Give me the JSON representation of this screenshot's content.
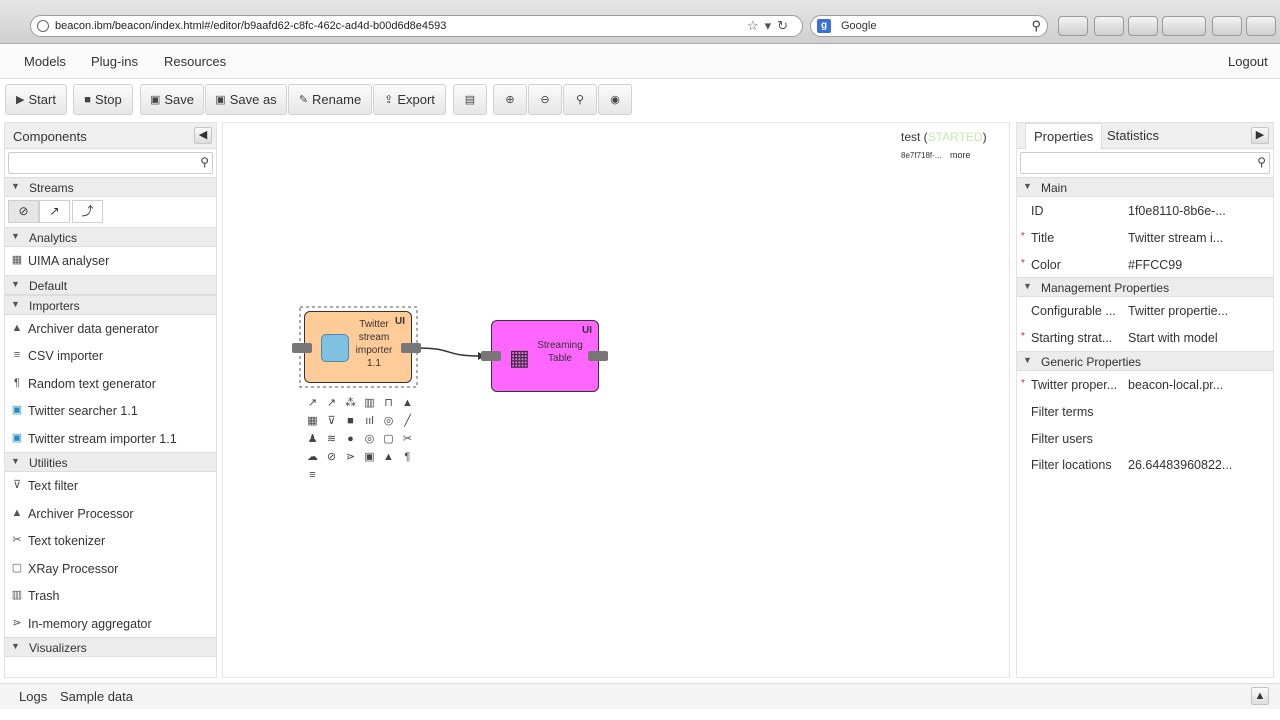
{
  "browser": {
    "url": "beacon.ibm/beacon/index.html#/editor/b9aafd62-c8fc-462c-ad4d-b00d6d8e4593",
    "search_engine": "Google"
  },
  "nav": {
    "models": "Models",
    "plugins": "Plug-ins",
    "resources": "Resources",
    "logout": "Logout"
  },
  "toolbar": {
    "start": "Start",
    "stop": "Stop",
    "save": "Save",
    "save_as": "Save as",
    "rename": "Rename",
    "export": "Export"
  },
  "components": {
    "title": "Components",
    "sections": {
      "streams": "Streams",
      "analytics": "Analytics",
      "default": "Default",
      "importers": "Importers",
      "utilities": "Utilities",
      "visualizers": "Visualizers"
    },
    "analytics": [
      "UIMA analyser"
    ],
    "importers": [
      "Archiver data generator",
      "CSV importer",
      "Random text generator",
      "Twitter searcher 1.1",
      "Twitter stream importer 1.1"
    ],
    "utilities": [
      "Text filter",
      "Archiver Processor",
      "Text tokenizer",
      "XRay Processor",
      "Trash",
      "In-memory aggregator"
    ]
  },
  "canvas": {
    "model_name": "test",
    "model_status": "STARTED",
    "model_rev": "8e7f718f-...",
    "more": "more",
    "node1": {
      "line1": "Twitter",
      "line2": "stream",
      "line3": "importer",
      "line4": "1.1",
      "badge": "UI",
      "color": "#FFCC99"
    },
    "node2": {
      "line1": "Streaming",
      "line2": "Table",
      "badge": "UI",
      "color": "#FF66FF"
    }
  },
  "properties": {
    "tab_properties": "Properties",
    "tab_statistics": "Statistics",
    "section_main": "Main",
    "section_management": "Management Properties",
    "section_generic": "Generic Properties",
    "main": [
      {
        "key": "ID",
        "value": "1f0e8110-8b6e-...",
        "required": false
      },
      {
        "key": "Title",
        "value": "Twitter stream i...",
        "required": true
      },
      {
        "key": "Color",
        "value": "#FFCC99",
        "required": true
      }
    ],
    "management": [
      {
        "key": "Configurable ...",
        "value": "Twitter propertie...",
        "required": false
      },
      {
        "key": "Starting strat...",
        "value": "Start with model",
        "required": true
      }
    ],
    "generic": [
      {
        "key": "Twitter proper...",
        "value": "beacon-local.pr...",
        "required": true
      },
      {
        "key": "Filter terms",
        "value": "",
        "required": false
      },
      {
        "key": "Filter users",
        "value": "",
        "required": false
      },
      {
        "key": "Filter locations",
        "value": "26.64483960822...",
        "required": false
      }
    ]
  },
  "bottom": {
    "logs": "Logs",
    "sample_data": "Sample data"
  }
}
